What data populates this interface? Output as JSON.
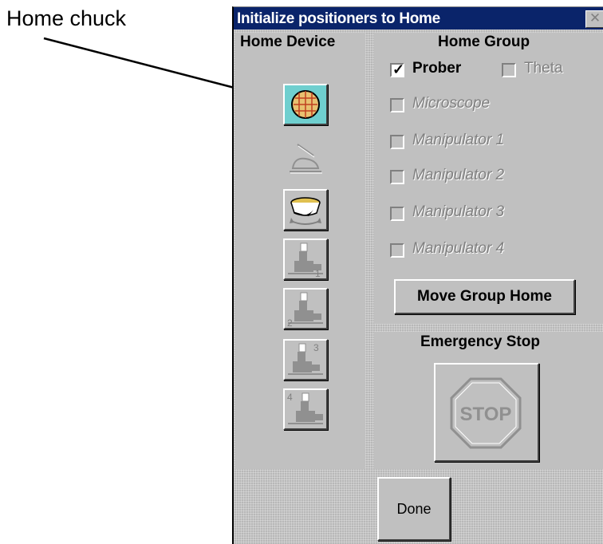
{
  "annotation": {
    "callout_text": "Home chuck"
  },
  "dialog": {
    "title": "Initialize positioners to Home",
    "close_glyph": "✕"
  },
  "home_device": {
    "header": "Home Device",
    "buttons": [
      {
        "name": "chuck",
        "icon": "wafer-chuck-icon",
        "enabled": true,
        "active": true
      },
      {
        "name": "microscope",
        "icon": "microscope-icon",
        "enabled": false
      },
      {
        "name": "theta",
        "icon": "theta-platen-icon",
        "enabled": true
      },
      {
        "name": "manipulator-1",
        "icon": "manipulator-icon",
        "number": "1",
        "enabled": false
      },
      {
        "name": "manipulator-2",
        "icon": "manipulator-icon",
        "number": "2",
        "enabled": false
      },
      {
        "name": "manipulator-3",
        "icon": "manipulator-icon",
        "number": "3",
        "enabled": false
      },
      {
        "name": "manipulator-4",
        "icon": "manipulator-icon",
        "number": "4",
        "enabled": false
      }
    ]
  },
  "home_group": {
    "header": "Home Group",
    "prober": {
      "label": "Prober",
      "checked": true,
      "check_glyph": "✓"
    },
    "theta": {
      "label": "Theta",
      "checked": false
    },
    "microscope": {
      "label": "Microscope",
      "checked": false
    },
    "manipulator_1": {
      "label": "Manipulator 1",
      "checked": false
    },
    "manipulator_2": {
      "label": "Manipulator 2",
      "checked": false
    },
    "manipulator_3": {
      "label": "Manipulator 3",
      "checked": false
    },
    "manipulator_4": {
      "label": "Manipulator 4",
      "checked": false
    },
    "move_button": "Move Group Home"
  },
  "emergency": {
    "header": "Emergency Stop",
    "stop_text": "STOP"
  },
  "footer": {
    "done_label": "Done"
  },
  "colors": {
    "titlebar": "#0a246a",
    "face": "#c0c0c0",
    "active_button": "#6fcfcf",
    "disabled_text": "#808080"
  }
}
